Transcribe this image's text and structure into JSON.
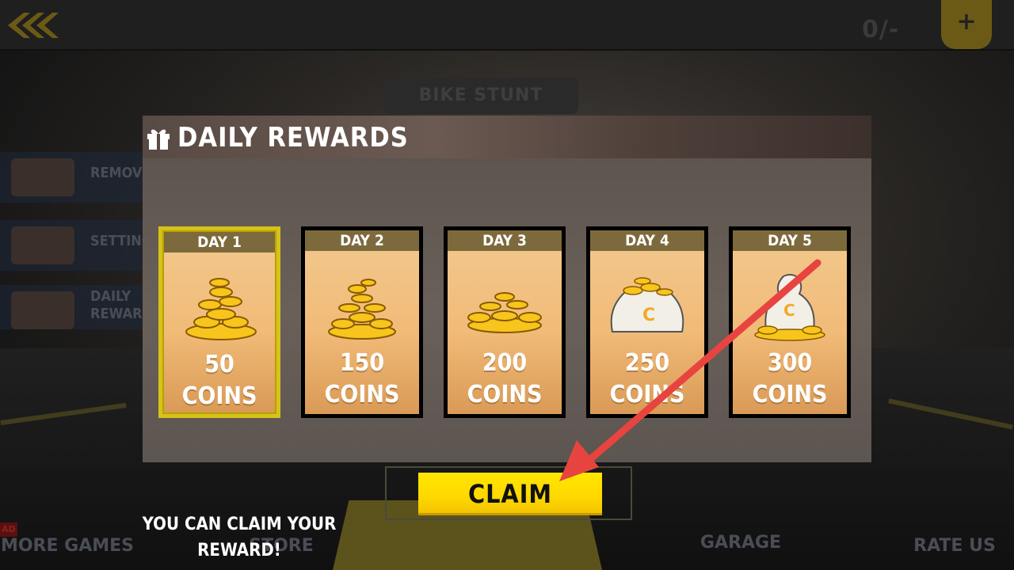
{
  "topbar": {
    "coin_display": "0/-",
    "plus_label": "+"
  },
  "background": {
    "bike_stunt_label": "BIKE STUNT",
    "side_menu": [
      {
        "label": "REMOVE"
      },
      {
        "label": "SETTING"
      },
      {
        "label": "DAILY REWARD"
      }
    ],
    "bottom": {
      "ad_tag": "AD",
      "more_games": "MORE GAMES",
      "store": "STORE",
      "garage": "GARAGE",
      "rate_us": "RATE US"
    }
  },
  "dialog": {
    "title": "DAILY REWARDS",
    "cards": [
      {
        "day": "DAY 1",
        "amount": "50",
        "unit": "COINS",
        "icon": "coin-pile-icon",
        "selected": true
      },
      {
        "day": "DAY 2",
        "amount": "150",
        "unit": "COINS",
        "icon": "coin-pile-icon",
        "selected": false
      },
      {
        "day": "DAY 3",
        "amount": "200",
        "unit": "COINS",
        "icon": "coin-pile-icon",
        "selected": false
      },
      {
        "day": "DAY 4",
        "amount": "250",
        "unit": "COINS",
        "icon": "coin-sack-icon",
        "selected": false
      },
      {
        "day": "DAY 5",
        "amount": "300",
        "unit": "COINS",
        "icon": "coin-sack-icon",
        "selected": false
      }
    ],
    "claim_button": "CLAIM",
    "claim_message_line1": "YOU CAN CLAIM YOUR",
    "claim_message_line2": "REWARD!"
  },
  "colors": {
    "accent_yellow": "#ffe600",
    "arrow_red": "#e8443f",
    "card_header": "#7d6a3c"
  }
}
